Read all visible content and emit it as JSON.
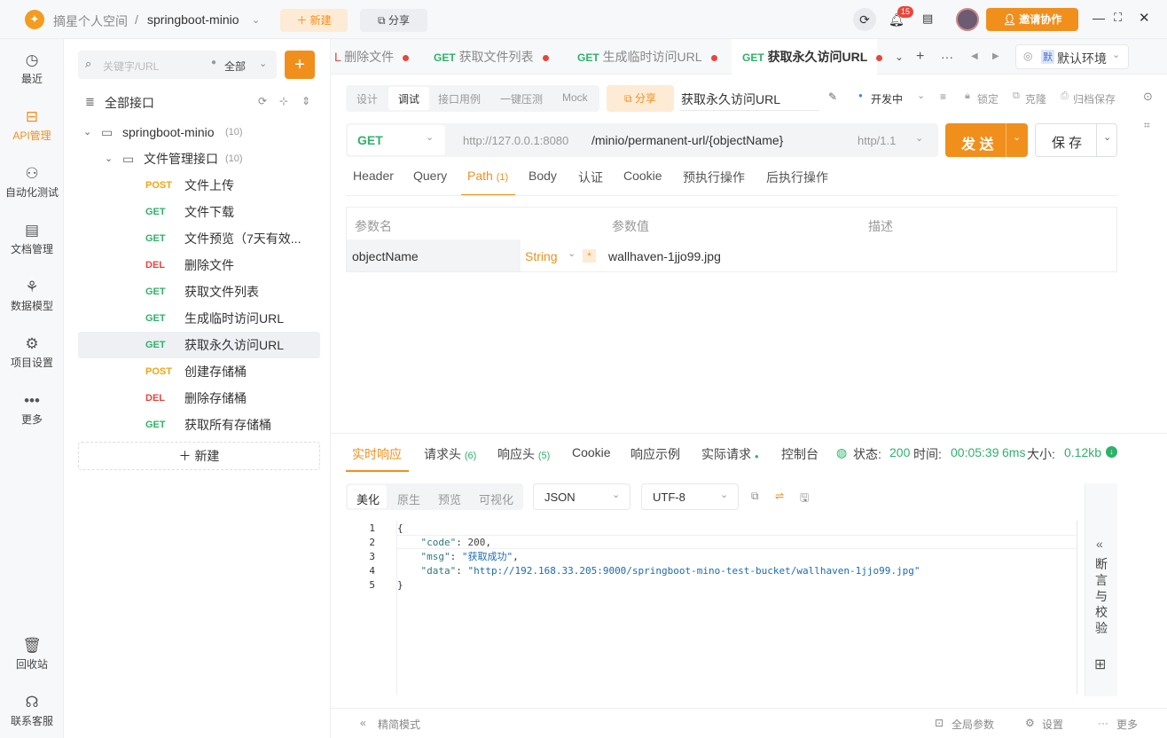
{
  "topbar": {
    "workspace": "摘星个人空间",
    "separator": "/",
    "project": "springboot-minio",
    "new_label": "新建",
    "share_label": "分享",
    "notif_count": "15",
    "invite_label": "邀请协作"
  },
  "leftnav": {
    "items": [
      {
        "label": "最近",
        "icon": "clock-icon"
      },
      {
        "label": "API管理",
        "icon": "api-icon"
      },
      {
        "label": "自动化测试",
        "icon": "automation-icon"
      },
      {
        "label": "文档管理",
        "icon": "document-icon"
      },
      {
        "label": "数据模型",
        "icon": "model-icon"
      },
      {
        "label": "项目设置",
        "icon": "settings-icon"
      },
      {
        "label": "更多",
        "icon": "more-icon"
      },
      {
        "label": "回收站",
        "icon": "trash-icon"
      },
      {
        "label": "联系客服",
        "icon": "headset-icon"
      }
    ]
  },
  "tree": {
    "search_placeholder": "关键字/URL",
    "filter": "全部",
    "root_label": "全部接口",
    "project": {
      "name": "springboot-minio",
      "count": "(10)"
    },
    "folder": {
      "name": "文件管理接口",
      "count": "(10)"
    },
    "apis": [
      {
        "method": "POST",
        "name": "文件上传"
      },
      {
        "method": "GET",
        "name": "文件下载"
      },
      {
        "method": "GET",
        "name": "文件预览（7天有效..."
      },
      {
        "method": "DEL",
        "name": "删除文件"
      },
      {
        "method": "GET",
        "name": "获取文件列表"
      },
      {
        "method": "GET",
        "name": "生成临时访问URL"
      },
      {
        "method": "GET",
        "name": "获取永久访问URL"
      },
      {
        "method": "POST",
        "name": "创建存储桶"
      },
      {
        "method": "DEL",
        "name": "删除存储桶"
      },
      {
        "method": "GET",
        "name": "获取所有存储桶"
      }
    ],
    "new_label": "新建"
  },
  "tabs": {
    "items": [
      {
        "method": "L",
        "name": "删除文件"
      },
      {
        "method": "GET",
        "name": "获取文件列表"
      },
      {
        "method": "GET",
        "name": "生成临时访问URL"
      },
      {
        "method": "GET",
        "name": "获取永久访问URL"
      }
    ],
    "env_badge": "默",
    "env_label": "默认环境"
  },
  "subtabs": {
    "items": [
      "设计",
      "调试",
      "接口用例",
      "一键压测",
      "Mock"
    ],
    "share": "分享",
    "api_name": "获取永久访问URL",
    "status": "开发中",
    "lock": "锁定",
    "clone": "克隆",
    "archive": "归档保存"
  },
  "request": {
    "method": "GET",
    "base": "http://127.0.0.1:8080",
    "path": "/minio/permanent-url/{objectName}",
    "protocol": "http/1.1",
    "send": "发 送",
    "save": "保 存"
  },
  "paramtabs": [
    "Header",
    "Query",
    "Path",
    "(1)",
    "Body",
    "认证",
    "Cookie",
    "预执行操作",
    "后执行操作"
  ],
  "params": {
    "headers": [
      "参数名",
      "参数值",
      "描述"
    ],
    "row": {
      "name": "objectName",
      "type": "String",
      "required": "*",
      "value": "wallhaven-1jjo99.jpg"
    }
  },
  "response": {
    "tabs": [
      "实时响应",
      "请求头",
      "(6)",
      "响应头",
      "(5)",
      "Cookie",
      "响应示例",
      "实际请求",
      "控制台"
    ],
    "status_label": "状态:",
    "status": "200",
    "time_label": "时间:",
    "time": "00:05:39",
    "duration": "6ms",
    "size_label": "大小:",
    "size": "0.12kb",
    "view_modes": [
      "美化",
      "原生",
      "预览",
      "可视化"
    ],
    "format": "JSON",
    "encoding": "UTF-8",
    "side_panel": [
      "断",
      "言",
      "与",
      "校",
      "验"
    ],
    "lines": [
      "1",
      "2",
      "3",
      "4",
      "5"
    ],
    "body": {
      "l1": "{",
      "code_key": "\"code\"",
      "code_val": "200",
      "msg_key": "\"msg\"",
      "msg_val": "\"获取成功\"",
      "data_key": "\"data\"",
      "data_val": "\"http://192.168.33.205:9000/springboot-mino-test-bucket/wallhaven-1jjo99.jpg\"",
      "l5": "}"
    }
  },
  "bottom": {
    "simple_mode": "精简模式",
    "global_params": "全局参数",
    "settings": "设置",
    "more": "更多"
  },
  "colors": {
    "accent": "#f18f1c",
    "get": "#2eb26a",
    "post": "#f3a314",
    "del": "#e8453c"
  }
}
